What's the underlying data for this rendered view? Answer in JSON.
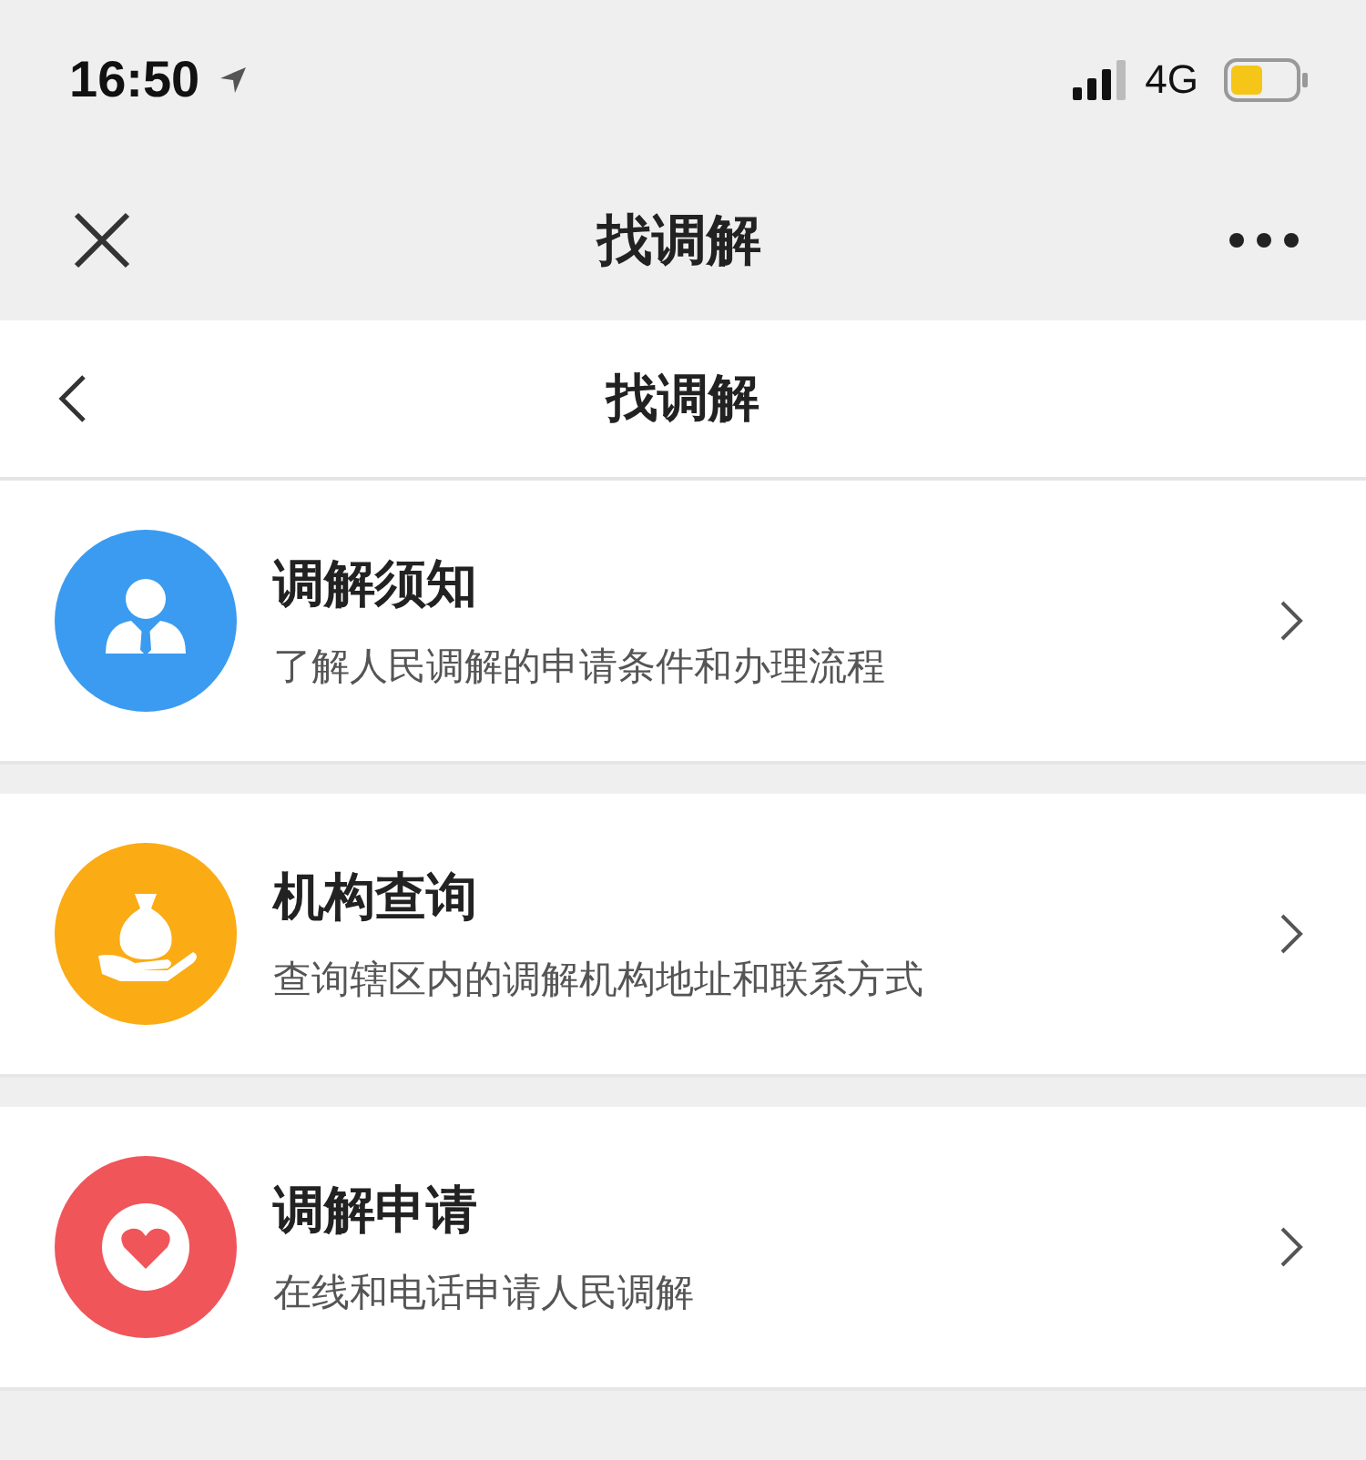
{
  "status_bar": {
    "time": "16:50",
    "network": "4G"
  },
  "nav_bar": {
    "title": "找调解"
  },
  "page_header": {
    "title": "找调解"
  },
  "items": [
    {
      "title": "调解须知",
      "subtitle": "了解人民调解的申请条件和办理流程",
      "color": "#3a9bf0"
    },
    {
      "title": "机构查询",
      "subtitle": "查询辖区内的调解机构地址和联系方式",
      "color": "#fbab14"
    },
    {
      "title": "调解申请",
      "subtitle": "在线和电话申请人民调解",
      "color": "#f0555a"
    }
  ]
}
